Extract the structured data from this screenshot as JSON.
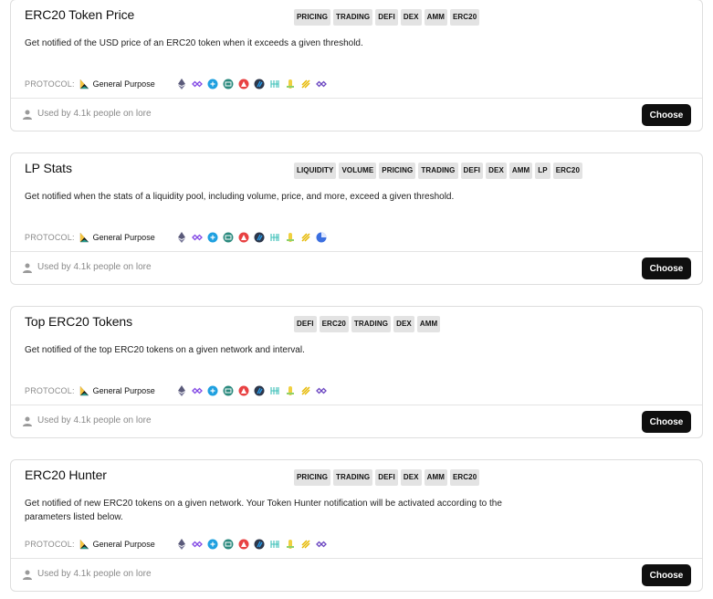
{
  "protocol_label": "PROTOCOL:",
  "choose_label": "Choose",
  "chain_icons": [
    "ethereum-icon",
    "polygon-icon",
    "zksync-icon",
    "base-icon",
    "optimism-icon",
    "arbitrum-icon",
    "avalanche-icon",
    "near-icon",
    "linea-icon",
    "bsc-icon",
    "polygon-icon"
  ],
  "colors": {
    "accent": "#0f0f0f",
    "tag_bg": "#e3e3e3",
    "muted": "#8a8a8a",
    "border": "#dedede"
  },
  "cards": [
    {
      "title": "ERC20 Token Price",
      "tags": [
        "PRICING",
        "TRADING",
        "DEFI",
        "DEX",
        "AMM",
        "ERC20"
      ],
      "description": "Get notified of the USD price of an ERC20 token when it exceeds a given threshold.",
      "protocol": "General Purpose",
      "used_by": "Used by 4.1k people on lore"
    },
    {
      "title": "LP Stats",
      "tags": [
        "LIQUIDITY",
        "VOLUME",
        "PRICING",
        "TRADING",
        "DEFI",
        "DEX",
        "AMM",
        "LP",
        "ERC20"
      ],
      "description": "Get notified when the stats of a liquidity pool, including volume, price, and more, exceed a given threshold.",
      "protocol": "General Purpose",
      "used_by": "Used by 4.1k people on lore"
    },
    {
      "title": "Top ERC20 Tokens",
      "tags": [
        "DEFI",
        "ERC20",
        "TRADING",
        "DEX",
        "AMM"
      ],
      "description": "Get notified of the top ERC20 tokens on a given network and interval.",
      "protocol": "General Purpose",
      "used_by": "Used by 4.1k people on lore"
    },
    {
      "title": "ERC20 Hunter",
      "tags": [
        "PRICING",
        "TRADING",
        "DEFI",
        "DEX",
        "AMM",
        "ERC20"
      ],
      "description": "Get notified of new ERC20 tokens on a given network. Your Token Hunter notification will be activated according to the parameters listed below.",
      "protocol": "General Purpose",
      "used_by": "Used by 4.1k people on lore"
    }
  ]
}
